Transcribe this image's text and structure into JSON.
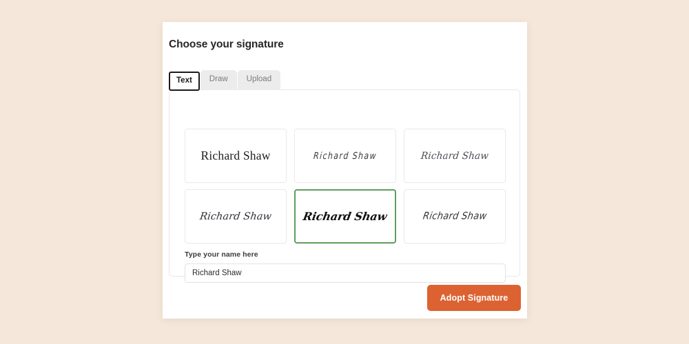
{
  "theme": {
    "page_background": "#f5e7d9",
    "card_background": "#ffffff",
    "accent_button": "#dd6232",
    "selected_border": "#5d9e5f",
    "title_color": "#262626"
  },
  "dialog": {
    "title": "Choose your signature"
  },
  "tabs": [
    {
      "label": "Text",
      "active": true
    },
    {
      "label": "Draw",
      "active": false
    },
    {
      "label": "Upload",
      "active": false
    }
  ],
  "signature_options": [
    {
      "text": "Richard Shaw",
      "style": "serif",
      "selected": false
    },
    {
      "text": "Richard Shaw",
      "style": "thin-hand",
      "selected": false
    },
    {
      "text": "Richard Shaw",
      "style": "elegant-italic",
      "selected": false
    },
    {
      "text": "Richard Shaw",
      "style": "calligraphy",
      "selected": false
    },
    {
      "text": "Richard Shaw",
      "style": "brush-bold",
      "selected": true
    },
    {
      "text": "Richard Shaw",
      "style": "marker",
      "selected": false
    }
  ],
  "name_field": {
    "label": "Type your name here",
    "value": "Richard Shaw",
    "placeholder": "Type your name here"
  },
  "footer": {
    "adopt_label": "Adopt Signature"
  }
}
